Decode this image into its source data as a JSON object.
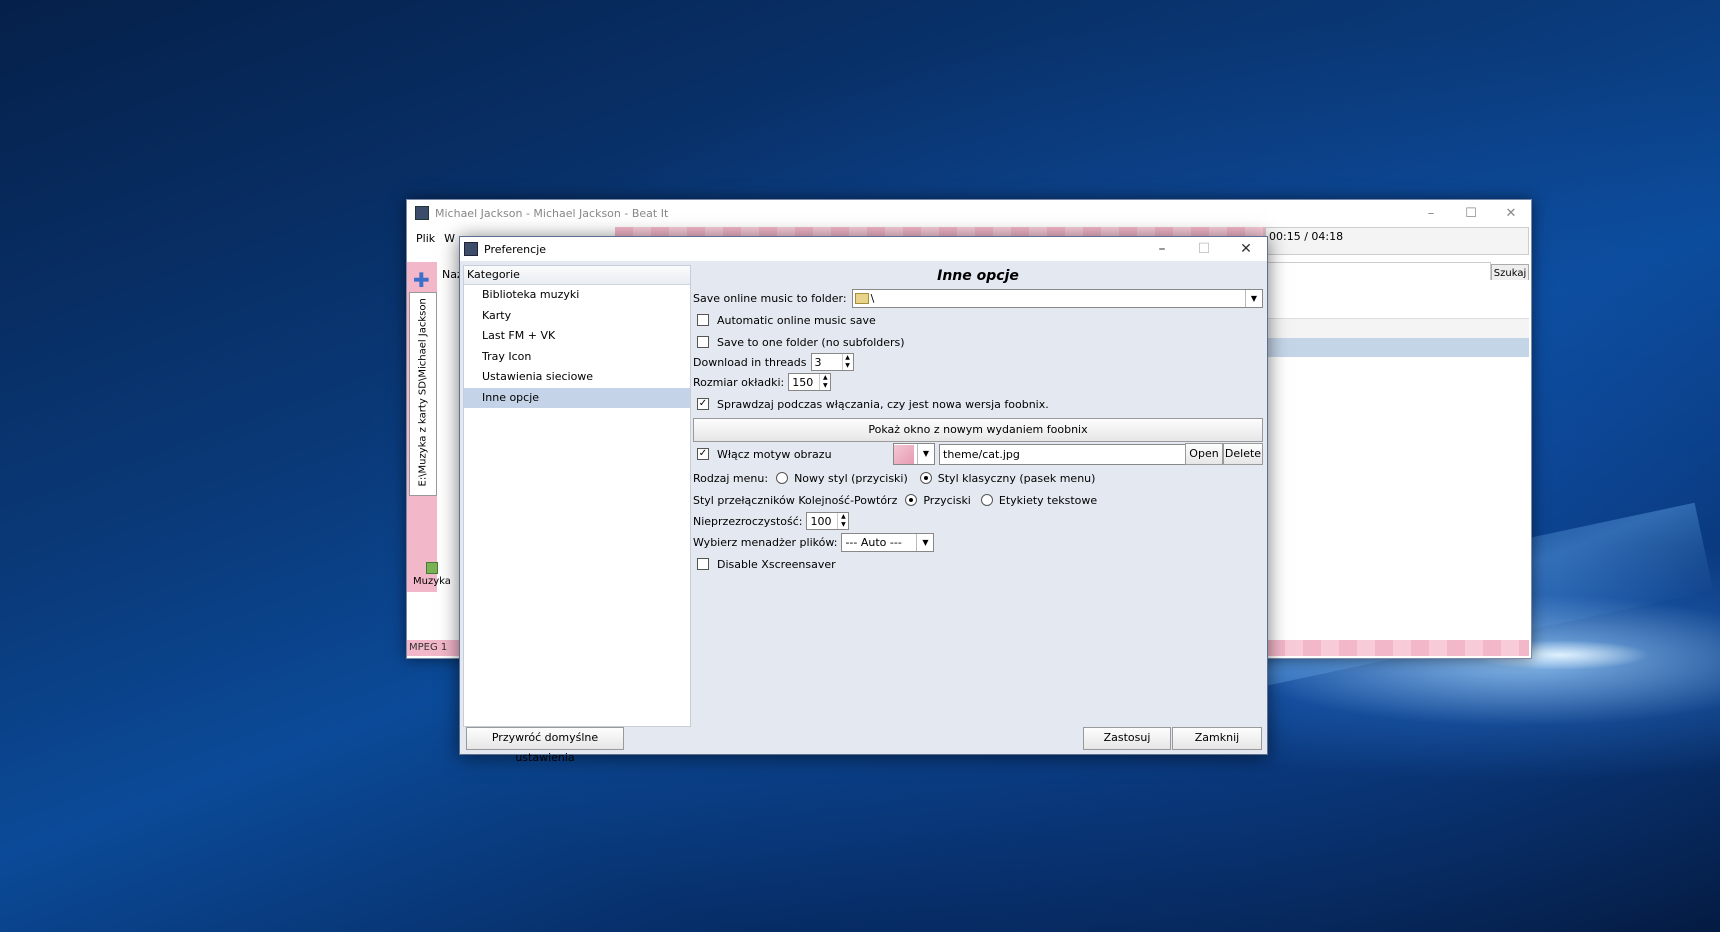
{
  "main_window": {
    "title": "Michael Jackson - Michael Jackson - Beat It",
    "menu": [
      "Plik",
      "W"
    ],
    "time": "00:15 / 04:18",
    "search_button": "Szukaj",
    "col_header": "Naz",
    "vertical_tab": "E:\\Muzyka z karty SD\\Michael Jackson",
    "vertical_tab_close": "×",
    "music_label": "Muzyka",
    "status": "MPEG 1 lay"
  },
  "dialog": {
    "title": "Preferencje",
    "categories_header": "Kategorie",
    "categories": [
      "Biblioteka muzyki",
      "Karty",
      "Last FM + VK",
      "Tray Icon",
      "Ustawienia sieciowe",
      "Inne opcje"
    ],
    "selected_category": "Inne opcje",
    "heading": "Inne opcje",
    "save_folder_label": "Save online music to folder:",
    "save_folder_value": "\\",
    "auto_save_label": "Automatic online music save",
    "one_folder_label": "Save to one folder (no subfolders)",
    "threads_label": "Download in threads",
    "threads_value": "3",
    "cover_size_label": "Rozmiar okładki:",
    "cover_size_value": "150",
    "check_update_label": "Sprawdzaj podczas włączania, czy jest nowa wersja foobnix.",
    "check_update_checked": true,
    "show_release_button": "Pokaż okno z nowym wydaniem foobnix",
    "theme_label": "Włącz motyw obrazu",
    "theme_checked": true,
    "theme_path": "theme/cat.jpg",
    "open_button": "Open",
    "delete_button": "Delete",
    "menu_type_label": "Rodzaj menu:",
    "menu_type_new": "Nowy styl (przyciski)",
    "menu_type_classic": "Styl klasyczny (pasek menu)",
    "order_style_label": "Styl przełączników Kolejność-Powtórz",
    "order_style_buttons": "Przyciski",
    "order_style_labels": "Etykiety tekstowe",
    "opacity_label": "Nieprzezroczystość:",
    "opacity_value": "100",
    "file_manager_label": "Wybierz menadżer plików:",
    "file_manager_value": "--- Auto ---",
    "xscreensaver_label": "Disable Xscreensaver",
    "restore_button": "Przywróć domyślne ustawienia",
    "apply_button": "Zastosuj",
    "close_button": "Zamknij"
  }
}
